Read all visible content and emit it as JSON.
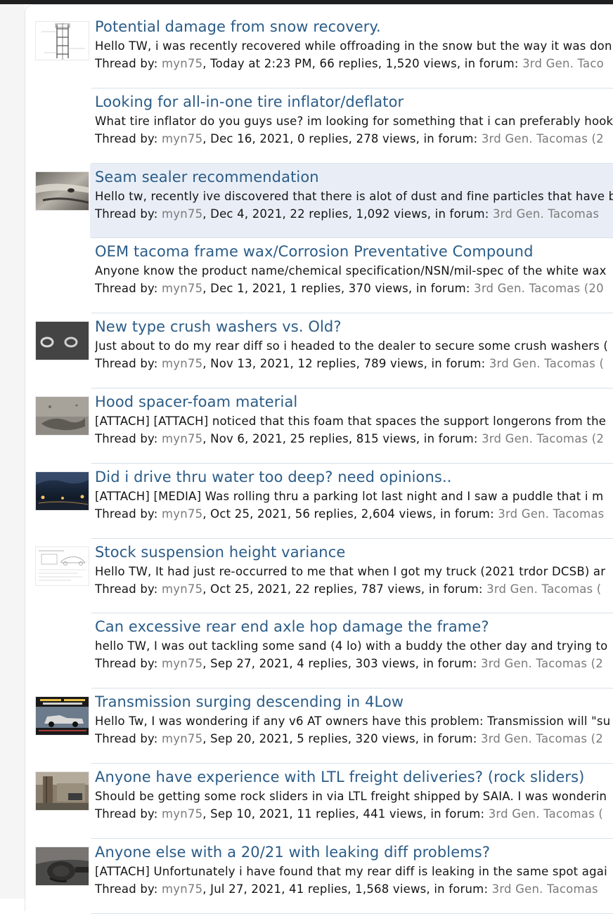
{
  "results": [
    {
      "title": "Potential damage from snow recovery.",
      "snippet": "Hello TW, i was recently recovered while offroading in the snow but the way it was don",
      "prefix": "Thread by: ",
      "user": "myn75",
      "details": ", Today at 2:23 PM, 66 replies, 1,520 views, in forum: ",
      "forum": "3rd Gen. Taco",
      "thumbnail": "frame-diagram-icon"
    },
    {
      "title": "Looking for all-in-one tire inflator/deflator",
      "snippet": "What tire inflator do you guys use? im looking for something that i can preferably hook",
      "prefix": "Thread by: ",
      "user": "myn75",
      "details": ", Dec 16, 2021, 0 replies, 278 views, in forum: ",
      "forum": "3rd Gen. Tacomas (2",
      "thumbnail": ""
    },
    {
      "title": "Seam sealer recommendation",
      "snippet": "Hello tw, recently ive discovered that there is alot of dust and fine particles that have b",
      "prefix": "Thread by: ",
      "user": "myn75",
      "details": ", Dec 4, 2021, 22 replies, 1,092 views, in forum: ",
      "forum": "3rd Gen. Tacomas",
      "thumbnail": "seam-photo-icon"
    },
    {
      "title": "OEM tacoma frame wax/Corrosion Preventative Compound",
      "snippet": "Anyone know the product name/chemical specification/NSN/mil-spec of the white wax",
      "prefix": "Thread by: ",
      "user": "myn75",
      "details": ", Dec 1, 2021, 1 replies, 370 views, in forum: ",
      "forum": "3rd Gen. Tacomas (20",
      "thumbnail": ""
    },
    {
      "title": "New type crush washers vs. Old?",
      "snippet": "Just about to do my rear diff so i headed to the dealer to secure some crush washers (",
      "prefix": "Thread by: ",
      "user": "myn75",
      "details": ", Nov 13, 2021, 12 replies, 789 views, in forum: ",
      "forum": "3rd Gen. Tacomas (",
      "thumbnail": "washers-photo-icon"
    },
    {
      "title": "Hood spacer-foam material",
      "snippet": "[ATTACH] [ATTACH] noticed that this foam that spaces the support longerons from the",
      "prefix": "Thread by: ",
      "user": "myn75",
      "details": ", Nov 6, 2021, 25 replies, 815 views, in forum: ",
      "forum": "3rd Gen. Tacomas (2",
      "thumbnail": "foam-photo-icon"
    },
    {
      "title": "Did i drive thru water too deep? need opinions..",
      "snippet": "[ATTACH] [MEDIA] Was rolling thru a parking lot last night and I saw a puddle that i m",
      "prefix": "Thread by: ",
      "user": "myn75",
      "details": ", Oct 25, 2021, 56 replies, 2,604 views, in forum: ",
      "forum": "3rd Gen. Tacomas",
      "thumbnail": "night-water-photo-icon"
    },
    {
      "title": "Stock suspension height variance",
      "snippet": "Hello TW, It had just re-occurred to me that when I got my truck (2021 trdor DCSB) ar",
      "prefix": "Thread by: ",
      "user": "myn75",
      "details": ", Oct 25, 2021, 22 replies, 787 views, in forum: ",
      "forum": "3rd Gen. Tacomas (",
      "thumbnail": "spec-sheet-icon"
    },
    {
      "title": "Can excessive rear end axle hop damage the frame?",
      "snippet": "hello TW, I was out tackling some sand (4 lo) with a buddy the other day and trying to",
      "prefix": "Thread by: ",
      "user": "myn75",
      "details": ", Sep 27, 2021, 4 replies, 303 views, in forum: ",
      "forum": "3rd Gen. Tacomas (2",
      "thumbnail": ""
    },
    {
      "title": "Transmission surging descending in 4Low",
      "snippet": "Hello Tw, I was wondering if any v6 AT owners have this problem: Transmission will \"su",
      "prefix": "Thread by: ",
      "user": "myn75",
      "details": ", Sep 20, 2021, 5 replies, 320 views, in forum: ",
      "forum": "3rd Gen. Tacomas (2",
      "thumbnail": "truck-video-icon"
    },
    {
      "title": "Anyone have experience with LTL freight deliveries? (rock sliders)",
      "snippet": "Should be getting some rock sliders in via LTL freight shipped by SAIA. I was wonderin",
      "prefix": "Thread by: ",
      "user": "myn75",
      "details": ", Sep 10, 2021, 11 replies, 441 views, in forum: ",
      "forum": "3rd Gen. Tacomas (",
      "thumbnail": "yard-photo-icon"
    },
    {
      "title": "Anyone else with a 20/21 with leaking diff problems?",
      "snippet": "[ATTACH] Unfortunately i have found that my rear diff is leaking in the same spot agai",
      "prefix": "Thread by: ",
      "user": "myn75",
      "details": ", Jul 27, 2021, 41 replies, 1,568 views, in forum: ",
      "forum": "3rd Gen. Tacomas",
      "thumbnail": "diff-photo-icon"
    }
  ]
}
